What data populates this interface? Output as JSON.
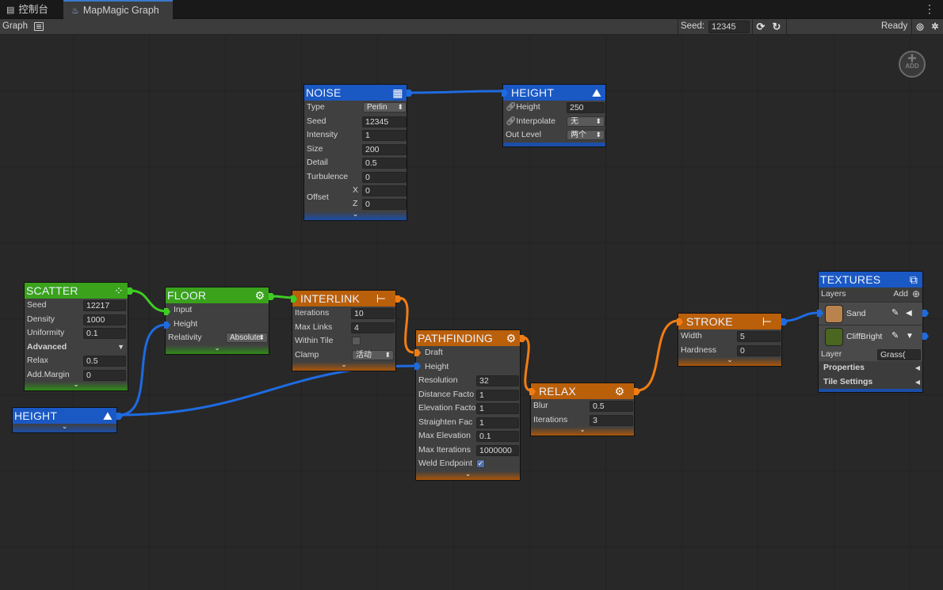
{
  "tabs": [
    {
      "icon": "console-icon",
      "label": "控制台"
    },
    {
      "icon": "mapmagic-icon",
      "label": "MapMagic Graph"
    }
  ],
  "toolbar": {
    "graph_label": "Graph",
    "seed_label": "Seed:",
    "seed_value": "12345",
    "status": "Ready"
  },
  "add_button": {
    "plus": "+",
    "label": "ADD"
  },
  "nodes": {
    "noise": {
      "title": "NOISE",
      "rows": {
        "type": {
          "label": "Type",
          "value": "Perlin"
        },
        "seed": {
          "label": "Seed",
          "value": "12345"
        },
        "intensity": {
          "label": "Intensity",
          "value": "1"
        },
        "size": {
          "label": "Size",
          "value": "200"
        },
        "detail": {
          "label": "Detail",
          "value": "0.5"
        },
        "turbulence": {
          "label": "Turbulence",
          "value": "0"
        },
        "offset": {
          "label": "Offset",
          "x_label": "X",
          "x_value": "0",
          "z_label": "Z",
          "z_value": "0"
        }
      }
    },
    "height_top": {
      "title": "HEIGHT",
      "rows": {
        "height": {
          "label": "Height",
          "value": "250"
        },
        "interpolate": {
          "label": "Interpolate",
          "value": "无"
        },
        "out_level": {
          "label": "Out Level",
          "value": "两个"
        }
      }
    },
    "scatter": {
      "title": "SCATTER",
      "rows": {
        "seed": {
          "label": "Seed",
          "value": "12217"
        },
        "density": {
          "label": "Density",
          "value": "1000"
        },
        "uniformity": {
          "label": "Uniformity",
          "value": "0.1"
        },
        "advanced": {
          "label": "Advanced"
        },
        "relax": {
          "label": "Relax",
          "value": "0.5"
        },
        "add_margin": {
          "label": "Add.Margin",
          "value": "0"
        }
      }
    },
    "floor": {
      "title": "FLOOR",
      "rows": {
        "input": {
          "label": "Input"
        },
        "height": {
          "label": "Height"
        },
        "relativity": {
          "label": "Relativity",
          "value": "Absolute"
        }
      }
    },
    "height_bottom": {
      "title": "HEIGHT"
    },
    "interlink": {
      "title": "INTERLINK",
      "rows": {
        "iterations": {
          "label": "Iterations",
          "value": "10"
        },
        "max_links": {
          "label": "Max Links",
          "value": "4"
        },
        "within_tile": {
          "label": "Within Tile",
          "checked": false
        },
        "clamp": {
          "label": "Clamp",
          "value": "活动"
        }
      }
    },
    "pathfinding": {
      "title": "PATHFINDING",
      "rows": {
        "draft": {
          "label": "Draft"
        },
        "height": {
          "label": "Height"
        },
        "resolution": {
          "label": "Resolution",
          "value": "32"
        },
        "distance_factor": {
          "label": "Distance Facto",
          "value": "1"
        },
        "elevation_factor": {
          "label": "Elevation Facto",
          "value": "1"
        },
        "straighten_factor": {
          "label": "Straighten Fac",
          "value": "1"
        },
        "max_elevation": {
          "label": "Max Elevation",
          "value": "0.1"
        },
        "max_iterations": {
          "label": "Max Iterations",
          "value": "1000000"
        },
        "weld_endpoints": {
          "label": "Weld Endpoint",
          "checked": true
        }
      }
    },
    "relax": {
      "title": "RELAX",
      "rows": {
        "blur": {
          "label": "Blur",
          "value": "0.5"
        },
        "iterations": {
          "label": "Iterations",
          "value": "3"
        }
      }
    },
    "stroke": {
      "title": "STROKE",
      "rows": {
        "width": {
          "label": "Width",
          "value": "5"
        },
        "hardness": {
          "label": "Hardness",
          "value": "0"
        }
      }
    },
    "textures": {
      "title": "TEXTURES",
      "layers_label": "Layers",
      "add_label": "Add",
      "layers": [
        {
          "name": "Sand",
          "color": "#b9834d"
        },
        {
          "name": "CliffBright",
          "color": "#4a6620"
        }
      ],
      "layer_field": {
        "label": "Layer",
        "value": "Grass("
      },
      "properties_label": "Properties",
      "tile_settings_label": "Tile Settings"
    }
  },
  "colors": {
    "blue_node": "#1a58c4",
    "green_node": "#3aa21b",
    "orange_node": "#ba5f0a",
    "blue_wire": "#1e6be0",
    "green_wire": "#3fcc24",
    "orange_wire": "#f07d14"
  }
}
